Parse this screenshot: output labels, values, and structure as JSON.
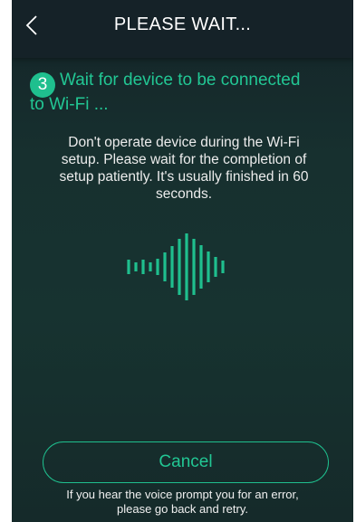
{
  "header": {
    "title": "PLEASE WAIT...",
    "back_icon": "chevron-left-icon"
  },
  "step": {
    "number": "3",
    "line1": "Wait for device to be connected",
    "line2": "to Wi-Fi ..."
  },
  "description": "Don't operate device during the Wi-Fi setup. Please wait for the completion of setup patiently. It's usually finished in 60 seconds.",
  "animation": {
    "icon": "sound-wave-icon",
    "color": "#1fbf8e"
  },
  "actions": {
    "cancel_label": "Cancel"
  },
  "footer": {
    "note_line1": "If you hear the voice prompt you for an error,",
    "note_line2": "please go back and retry."
  },
  "colors": {
    "accent": "#1fbf8e",
    "header_bg": "#152228",
    "background": "#173330"
  }
}
